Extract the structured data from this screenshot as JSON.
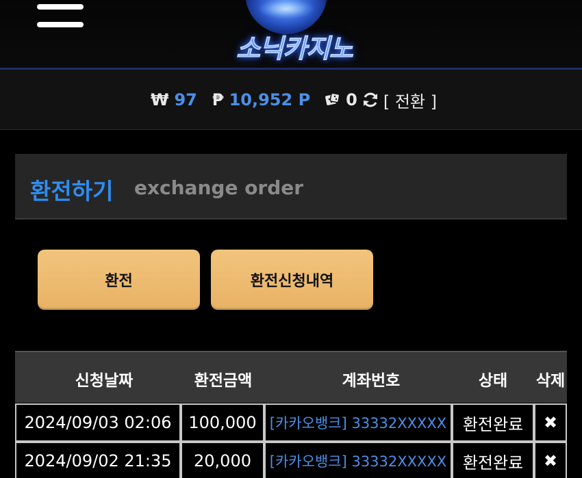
{
  "header": {
    "menu_icon": "hamburger-menu-icon",
    "logo_text": "소닉카지노"
  },
  "balance": {
    "won_symbol": "₩",
    "won_value": "97",
    "point_symbol": "₱",
    "point_value": "10,952 P",
    "dice_icon": "dice-icon",
    "dice_count": "0",
    "refresh_icon": "refresh-icon",
    "switch_label": "[ 전환 ]"
  },
  "title": {
    "main": "환전하기",
    "sub": "exchange order"
  },
  "buttons": {
    "exchange": "환전",
    "history": "환전신청내역"
  },
  "table": {
    "headers": [
      "신청날짜",
      "환전금액",
      "계좌번호",
      "상태",
      "삭제"
    ],
    "rows": [
      {
        "date": "2024/09/03 02:06",
        "amount": "100,000",
        "account": "[카카오뱅크] 33332XXXXX",
        "status": "환전완료",
        "delete": "✖"
      },
      {
        "date": "2024/09/02 21:35",
        "amount": "20,000",
        "account": "[카카오뱅크] 33332XXXXX",
        "status": "환전완료",
        "delete": "✖"
      }
    ]
  },
  "colors": {
    "accent_blue": "#2f8df0",
    "button_gold": "#f2c47c"
  }
}
